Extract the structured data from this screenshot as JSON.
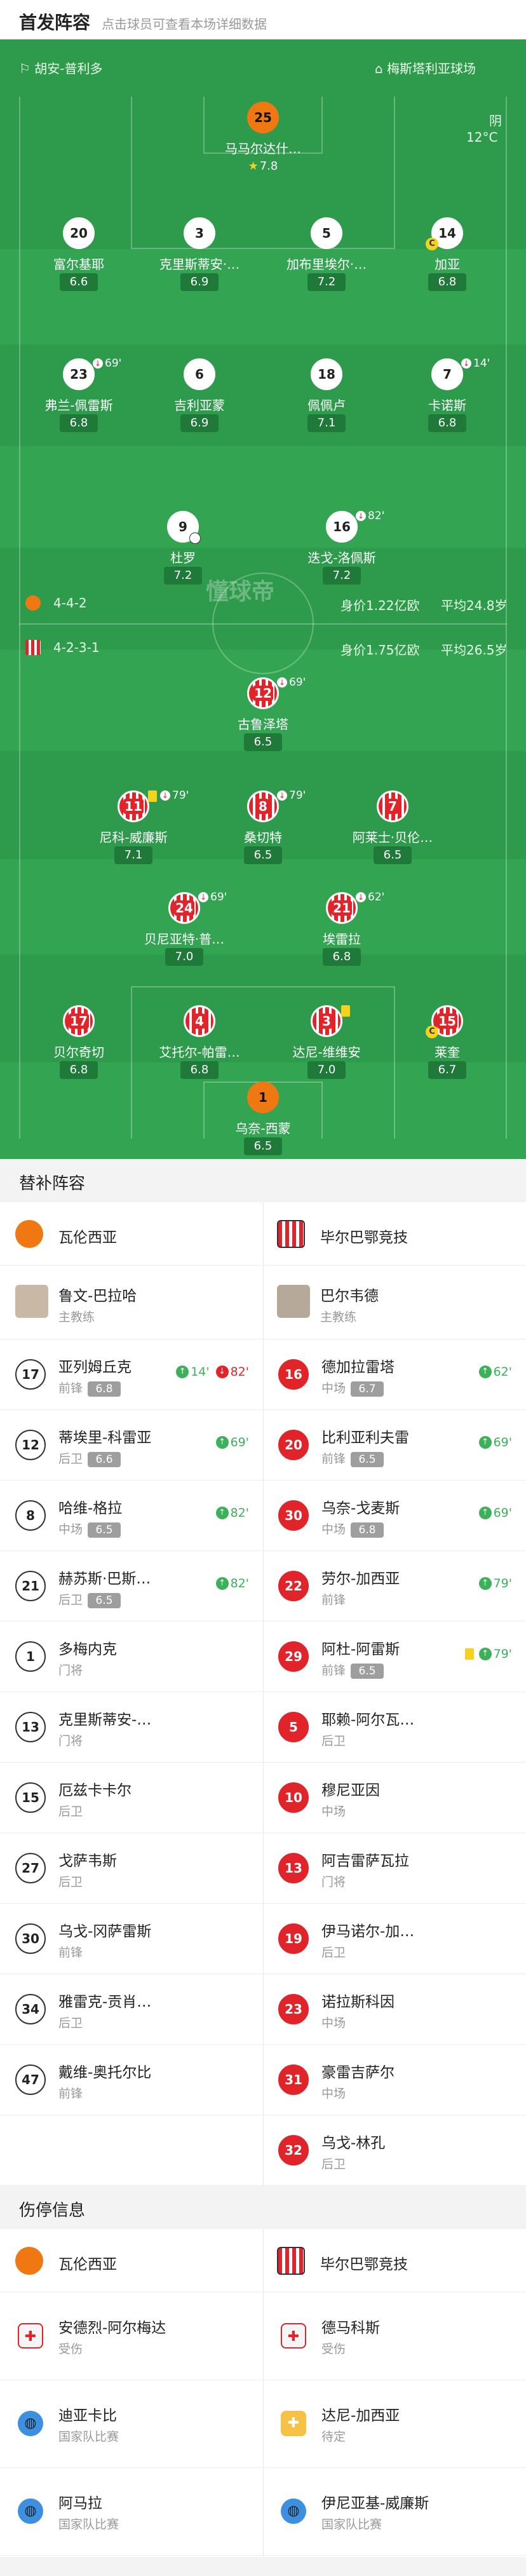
{
  "header": {
    "title": "首发阵容",
    "subtitle": "点击球员可查看本场详细数据"
  },
  "match": {
    "referee": "胡安-普利多",
    "stadium": "梅斯塔利亚球场",
    "weather": "阴",
    "temperature": "12°C",
    "watermark": "懂球帝"
  },
  "home_team": {
    "name": "瓦伦西亚",
    "formation": "4-4-2",
    "value": "身价1.22亿欧",
    "avg_age": "平均24.8岁",
    "players": [
      {
        "num": "25",
        "name": "马马尔达什…",
        "rating": "7.8",
        "star": true
      },
      {
        "num": "20",
        "name": "富尔基耶",
        "rating": "6.6"
      },
      {
        "num": "3",
        "name": "克里斯蒂安·…",
        "rating": "6.9"
      },
      {
        "num": "5",
        "name": "加布里埃尔·…",
        "rating": "7.2"
      },
      {
        "num": "14",
        "name": "加亚",
        "rating": "6.8",
        "captain": "C"
      },
      {
        "num": "23",
        "name": "弗兰-佩雷斯",
        "rating": "6.8",
        "sub": "69'"
      },
      {
        "num": "6",
        "name": "吉利亚蒙",
        "rating": "6.9"
      },
      {
        "num": "18",
        "name": "佩佩卢",
        "rating": "7.1"
      },
      {
        "num": "7",
        "name": "卡诺斯",
        "rating": "6.8",
        "sub": "14'"
      },
      {
        "num": "9",
        "name": "杜罗",
        "rating": "7.2",
        "goal": true
      },
      {
        "num": "16",
        "name": "迭戈-洛佩斯",
        "rating": "7.2",
        "sub": "82'"
      }
    ]
  },
  "away_team": {
    "name": "毕尔巴鄂竞技",
    "formation": "4-2-3-1",
    "value": "身价1.75亿欧",
    "avg_age": "平均26.5岁",
    "players": [
      {
        "num": "12",
        "name": "古鲁泽塔",
        "rating": "6.5",
        "sub": "69'"
      },
      {
        "num": "11",
        "name": "尼科-威廉斯",
        "rating": "7.1",
        "sub": "79'",
        "yellow": true
      },
      {
        "num": "8",
        "name": "桑切特",
        "rating": "6.5",
        "sub": "79'"
      },
      {
        "num": "7",
        "name": "阿莱士·贝伦…",
        "rating": "6.5"
      },
      {
        "num": "24",
        "name": "贝尼亚特·普…",
        "rating": "7.0",
        "sub": "69'"
      },
      {
        "num": "21",
        "name": "埃雷拉",
        "rating": "6.8",
        "sub": "62'"
      },
      {
        "num": "17",
        "name": "贝尔奇切",
        "rating": "6.8"
      },
      {
        "num": "4",
        "name": "艾托尔-帕雷…",
        "rating": "6.8"
      },
      {
        "num": "3",
        "name": "达尼-维维安",
        "rating": "7.0",
        "yellow": true
      },
      {
        "num": "15",
        "name": "莱奎",
        "rating": "6.7",
        "captain": "C"
      },
      {
        "num": "1",
        "name": "乌奈-西蒙",
        "rating": "6.5"
      }
    ]
  },
  "subs": {
    "title": "替补阵容",
    "coach_label": "主教练",
    "home_coach": "鲁文-巴拉哈",
    "away_coach": "巴尔韦德",
    "rows": [
      {
        "h": {
          "num": "17",
          "name": "亚列姆丘克",
          "pos": "前锋",
          "rating": "6.8",
          "ev1": "14'",
          "ev2": "82'"
        },
        "a": {
          "num": "16",
          "name": "德加拉雷塔",
          "pos": "中场",
          "rating": "6.7",
          "ev1": "62'"
        }
      },
      {
        "h": {
          "num": "12",
          "name": "蒂埃里-科雷亚",
          "pos": "后卫",
          "rating": "6.6",
          "ev1": "69'"
        },
        "a": {
          "num": "20",
          "name": "比利亚利夫雷",
          "pos": "前锋",
          "rating": "6.5",
          "ev1": "69'"
        }
      },
      {
        "h": {
          "num": "8",
          "name": "哈维-格拉",
          "pos": "中场",
          "rating": "6.5",
          "ev1": "82'"
        },
        "a": {
          "num": "30",
          "name": "乌奈-戈麦斯",
          "pos": "中场",
          "rating": "6.8",
          "ev1": "69'"
        }
      },
      {
        "h": {
          "num": "21",
          "name": "赫苏斯·巴斯…",
          "pos": "后卫",
          "rating": "6.5",
          "ev1": "82'"
        },
        "a": {
          "num": "22",
          "name": "劳尔-加西亚",
          "pos": "前锋",
          "rating": "",
          "ev1": "79'"
        }
      },
      {
        "h": {
          "num": "1",
          "name": "多梅内克",
          "pos": "门将",
          "rating": ""
        },
        "a": {
          "num": "29",
          "name": "阿杜-阿雷斯",
          "pos": "前锋",
          "rating": "6.5",
          "ev1": "79'",
          "yellow": true
        }
      },
      {
        "h": {
          "num": "13",
          "name": "克里斯蒂安-…",
          "pos": "门将",
          "rating": ""
        },
        "a": {
          "num": "5",
          "name": "耶赖-阿尔瓦…",
          "pos": "后卫",
          "rating": ""
        }
      },
      {
        "h": {
          "num": "15",
          "name": "厄兹卡卡尔",
          "pos": "后卫",
          "rating": ""
        },
        "a": {
          "num": "10",
          "name": "穆尼亚因",
          "pos": "中场",
          "rating": ""
        }
      },
      {
        "h": {
          "num": "27",
          "name": "戈萨韦斯",
          "pos": "后卫",
          "rating": ""
        },
        "a": {
          "num": "13",
          "name": "阿吉雷萨瓦拉",
          "pos": "门将",
          "rating": ""
        }
      },
      {
        "h": {
          "num": "30",
          "name": "乌戈-冈萨雷斯",
          "pos": "前锋",
          "rating": ""
        },
        "a": {
          "num": "19",
          "name": "伊马诺尔-加…",
          "pos": "后卫",
          "rating": ""
        }
      },
      {
        "h": {
          "num": "34",
          "name": "雅雷克-贡肖…",
          "pos": "后卫",
          "rating": ""
        },
        "a": {
          "num": "23",
          "name": "诺拉斯科因",
          "pos": "中场",
          "rating": ""
        }
      },
      {
        "h": {
          "num": "47",
          "name": "戴维-奥托尔比",
          "pos": "前锋",
          "rating": ""
        },
        "a": {
          "num": "31",
          "name": "豪雷吉萨尔",
          "pos": "中场",
          "rating": ""
        }
      },
      {
        "h": null,
        "a": {
          "num": "32",
          "name": "乌戈-林孔",
          "pos": "后卫",
          "rating": ""
        }
      }
    ]
  },
  "injuries": {
    "title": "伤停信息",
    "home": [
      {
        "name": "安德烈-阿尔梅达",
        "reason": "受伤",
        "icon": "medical-kit-icon"
      },
      {
        "name": "迪亚卡比",
        "reason": "国家队比赛",
        "icon": "globe-icon"
      },
      {
        "name": "阿马拉",
        "reason": "国家队比赛",
        "icon": "globe-icon"
      }
    ],
    "away": [
      {
        "name": "德马科斯",
        "reason": "受伤",
        "icon": "medical-kit-icon"
      },
      {
        "name": "达尼-加西亚",
        "reason": "待定",
        "icon": "clipboard-icon"
      },
      {
        "name": "伊尼亚基-威廉斯",
        "reason": "国家队比赛",
        "icon": "globe-icon"
      }
    ]
  },
  "colors": {
    "pitch": "#2d9a4c",
    "away_red": "#e0242a",
    "gk_orange": "#f07812",
    "rating_green": "#1f7a3a"
  }
}
